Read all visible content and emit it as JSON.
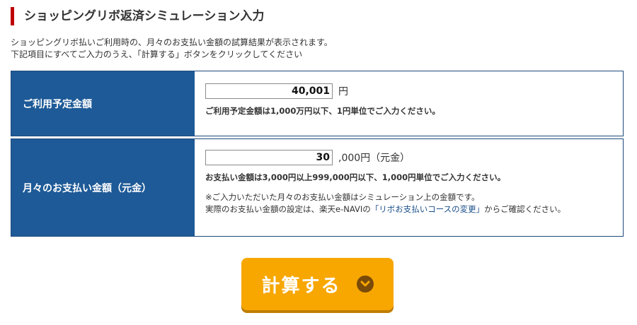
{
  "header": {
    "title": "ショッピングリボ返済シミュレーション入力"
  },
  "intro": {
    "line1": "ショッピングリボ払いご利用時の、月々のお支払い金額の試算結果が表示されます。",
    "line2": "下記項目にすべてご入力のうえ、「計算する」ボタンをクリックしてください"
  },
  "form": {
    "planned_amount": {
      "label": "ご利用予定金額",
      "value": "40,001",
      "unit": "円",
      "note": "ご利用予定金額は1,000万円以下、1円単位でご入力ください。"
    },
    "monthly_payment": {
      "label": "月々のお支払い金額（元金）",
      "value": "30",
      "unit": ",000円（元金）",
      "note": "お支払い金額は3,000円以上999,000円以下、1,000円単位でご入力ください。",
      "remark_line1": "※ご入力いただいた月々のお支払い金額はシミュレーション上の金額です。",
      "remark_line2_prefix": "実際のお支払い金額の設定は、楽天e-NAVIの",
      "remark_link": "「リボお支払いコースの変更」",
      "remark_line2_suffix": "からご確認ください。"
    }
  },
  "actions": {
    "calculate_label": "計算する"
  },
  "colors": {
    "accent_red": "#bf0000",
    "label_blue": "#1e5a97",
    "border_blue": "#1e4a7c",
    "button_orange": "#f7a700",
    "link_blue": "#1a4f8b"
  },
  "icons": {
    "button_icon": "chevron-down-icon"
  }
}
